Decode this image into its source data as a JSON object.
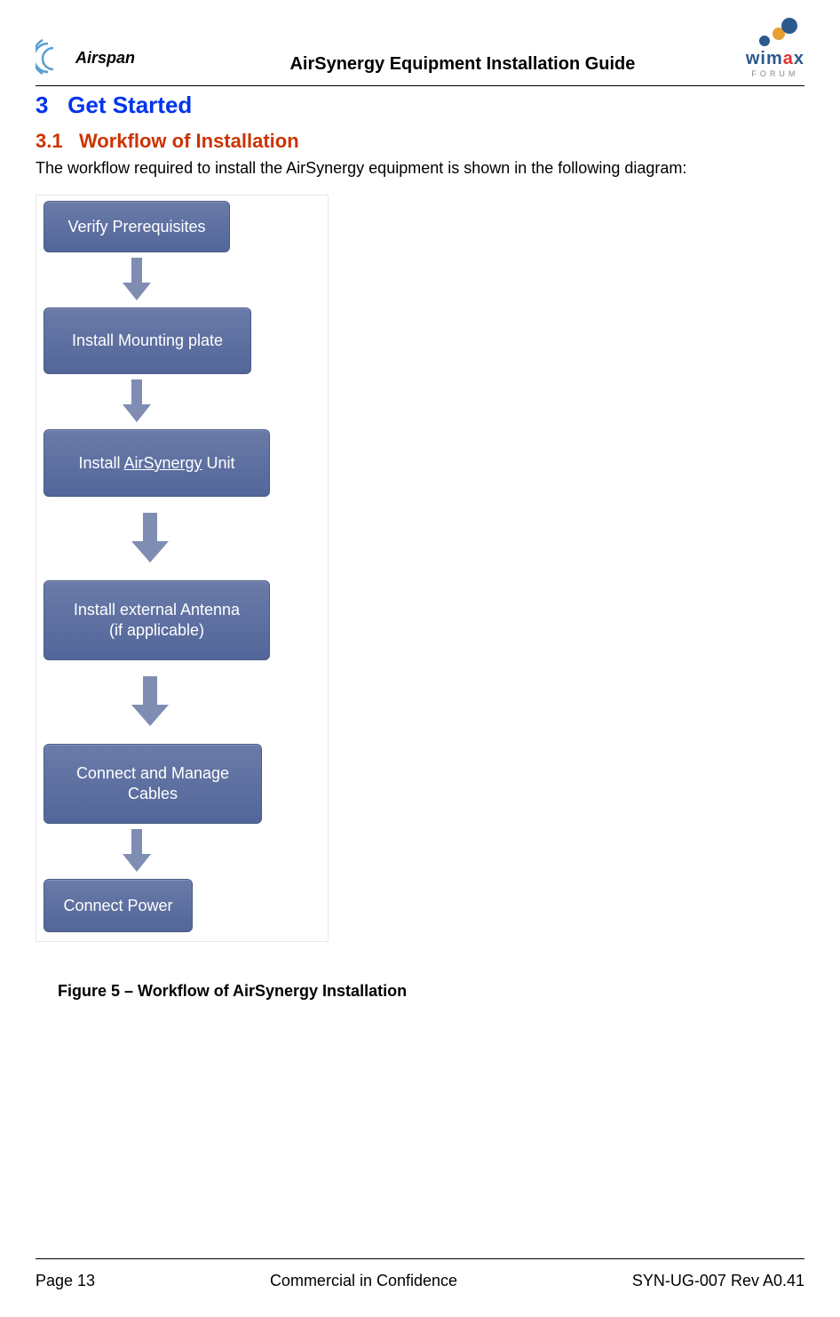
{
  "header": {
    "logo_left": "Airspan",
    "title": "AirSynergy Equipment Installation Guide",
    "logo_right_main": "wimax",
    "logo_right_sub": "FORUM"
  },
  "section": {
    "number": "3",
    "title": "Get Started"
  },
  "subsection": {
    "number": "3.1",
    "title": "Workflow of Installation"
  },
  "intro_text": "The workflow required to install the AirSynergy equipment is shown in the following diagram:",
  "flow": {
    "step1": "Verify Prerequisites",
    "step2": "Install Mounting plate",
    "step3_a": "Install ",
    "step3_b": "AirSynergy",
    "step3_c": " Unit",
    "step4_line1": "Install  external Antenna",
    "step4_line2": "(if applicable)",
    "step5_line1": "Connect and Manage",
    "step5_line2": "Cables",
    "step6": "Connect Power"
  },
  "figure_caption": "Figure 5  – Workflow of AirSynergy Installation",
  "footer": {
    "left": "Page 13",
    "center": "Commercial in Confidence",
    "right": "SYN-UG-007 Rev A0.41"
  }
}
